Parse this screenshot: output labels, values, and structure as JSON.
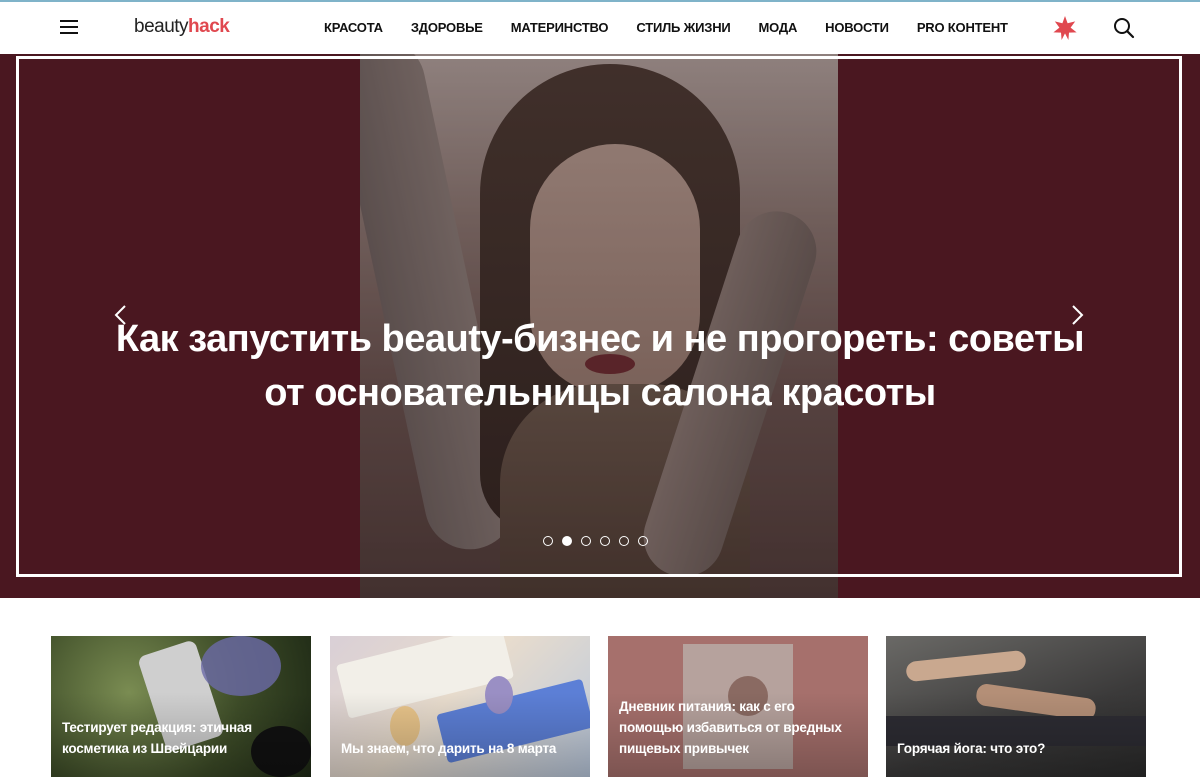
{
  "header": {
    "logo_left": "beauty",
    "logo_right": "hack",
    "menu_icon": "hamburger-menu-icon",
    "special_icon": "star-badge-icon",
    "search_icon": "search-icon",
    "nav": [
      {
        "label": "КРАСОТА"
      },
      {
        "label": "ЗДОРОВЬЕ"
      },
      {
        "label": "МАТЕРИНСТВО"
      },
      {
        "label": "СТИЛЬ ЖИЗНИ"
      },
      {
        "label": "МОДА"
      },
      {
        "label": "НОВОСТИ"
      },
      {
        "label": "PRO КОНТЕНТ"
      }
    ]
  },
  "hero": {
    "title": "Как запустить beauty-бизнес и не прогореть: советы от основательницы салона красоты",
    "prev_icon": "chevron-left-icon",
    "next_icon": "chevron-right-icon",
    "active_slide": 2,
    "slide_count": 6
  },
  "cards": [
    {
      "caption": "Тестирует редакция: этичная косметика из Швейцарии"
    },
    {
      "caption": "Мы знаем, что дарить на 8 марта"
    },
    {
      "caption": "Дневник питания: как с его помощью избавиться от вредных пищевых привычек"
    },
    {
      "caption": "Горячая йога: что это?"
    }
  ],
  "colors": {
    "brand_accent": "#e0484f",
    "hero_background": "#4a1720",
    "top_line": "#7fb3c9"
  }
}
